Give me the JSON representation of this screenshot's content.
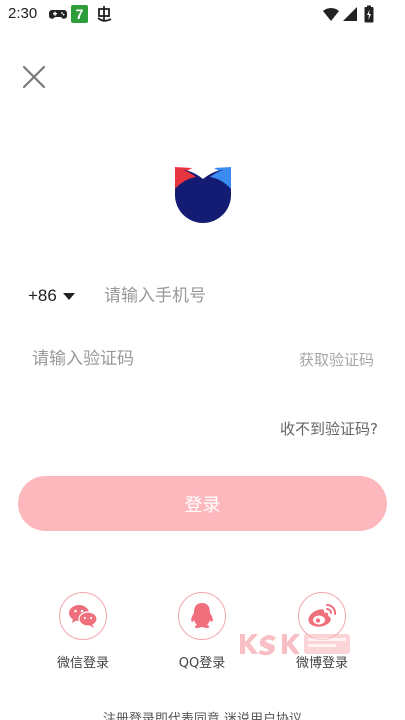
{
  "status_bar": {
    "time": "2:30",
    "icons": [
      "gamepad-icon",
      "app-7-icon",
      "app-bug-icon",
      "wifi-icon",
      "signal-icon",
      "battery-icon"
    ],
    "app_badge_text": "7",
    "app_badge_color": "#2e9e3a"
  },
  "header": {
    "close_icon": "close-icon"
  },
  "logo": {
    "icon": "app-logo-icon",
    "colors": {
      "left_ear": "#e8343e",
      "right_ear": "#3a8bf0",
      "face": "#141b73"
    }
  },
  "phone": {
    "country_code": "+86",
    "placeholder": "请输入手机号"
  },
  "verification": {
    "placeholder": "请输入验证码",
    "get_code_label": "获取验证码",
    "no_code_label": "收不到验证码?"
  },
  "login_button": {
    "label": "登录",
    "color": "#fdb8bd"
  },
  "social_login": [
    {
      "icon": "wechat-icon",
      "label": "微信登录"
    },
    {
      "icon": "qq-icon",
      "label": "QQ登录"
    },
    {
      "icon": "weibo-icon",
      "label": "微博登录"
    }
  ],
  "social_icon_color": "#f06f7c",
  "agreement": {
    "text": "注册登录即代表同意 迷说用户协议"
  }
}
